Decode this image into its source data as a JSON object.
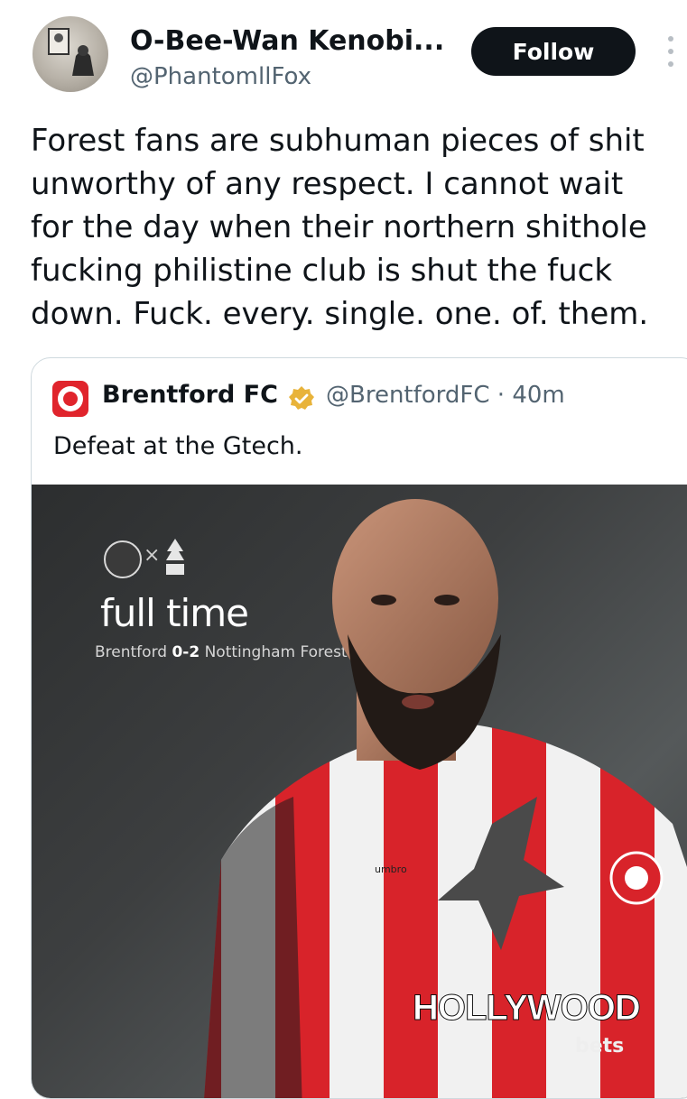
{
  "author": {
    "display_name": "O-Bee-Wan Kenobi...",
    "handle": "@PhantomllFox"
  },
  "actions": {
    "follow_label": "Follow",
    "more_icon": "vertical-ellipsis-icon"
  },
  "tweet": {
    "lines": [
      "Forest fans are subhuman pieces of shit",
      "unworthy of any respect. I cannot wait",
      "for the day when their northern shithole",
      "fucking philistine club is shut the fuck",
      "down. Fuck. every. single. one. of. them."
    ]
  },
  "quoted": {
    "name": "Brentford FC",
    "verified_icon": "verified-badge-icon",
    "handle_time": "@BrentfordFC · 40m",
    "text": "Defeat at the Gtech.",
    "media": {
      "title": "full time",
      "score_home": "Brentford ",
      "score": "0-2",
      "score_away": " Nottingham Forest",
      "sponsor": "HOLLYWOOD",
      "sponsor_sub": "bets",
      "kit_brand": "umbro"
    }
  },
  "colors": {
    "follow_bg": "#0f1419",
    "brand_red": "#e0242c",
    "handle_gray": "#536471",
    "verified_gold": "#e8b33a"
  }
}
